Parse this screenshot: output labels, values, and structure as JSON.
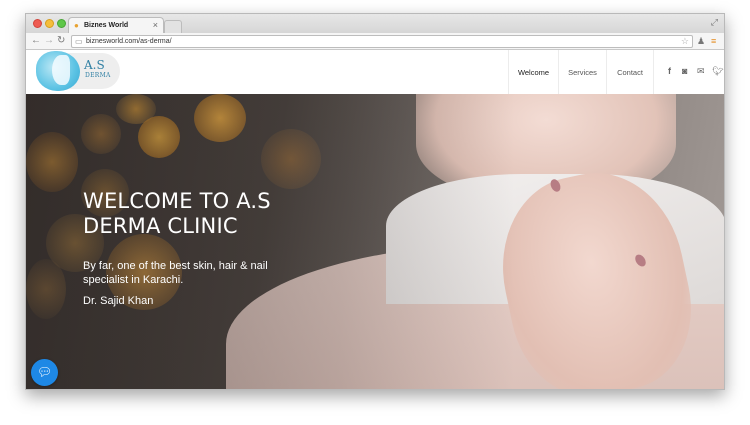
{
  "browser": {
    "tab_title": "Biznes World",
    "tab_close": "×",
    "url": "biznesworld.com/as-derma/",
    "icons": {
      "back": "back-arrow-icon",
      "forward": "forward-arrow-icon",
      "reload": "reload-icon",
      "star": "bookmark-star-icon",
      "extension": "extension-icon",
      "menu": "hamburger-menu-icon"
    }
  },
  "site": {
    "logo_text": "A.S",
    "logo_sub": "DERMA",
    "nav": [
      "Welcome",
      "Services",
      "Contact"
    ],
    "social_icons": [
      "facebook-icon",
      "instagram-icon",
      "mail-icon",
      "twitter-icon"
    ]
  },
  "hero": {
    "title": "WELCOME TO A.S DERMA CLINIC",
    "subtitle": "By far, one of the best skin, hair & nail specialist in Karachi.",
    "author": "Dr. Sajid Khan"
  },
  "colors": {
    "accent_blue": "#1e88e5",
    "logo_blue": "#37a7d1",
    "menu_orange": "#e58b1f"
  }
}
